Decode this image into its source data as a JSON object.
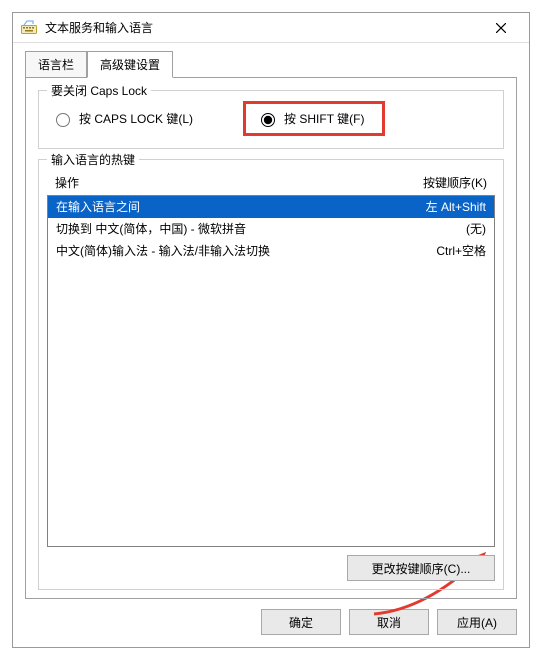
{
  "window": {
    "title": "文本服务和输入语言"
  },
  "tabs": {
    "tab0": "语言栏",
    "tab1": "高级键设置"
  },
  "capslock": {
    "group_label": "要关闭 Caps Lock",
    "radio_capslock": "按 CAPS LOCK 键(L)",
    "radio_shift": "按 SHIFT 键(F)"
  },
  "hotkeys": {
    "group_label": "输入语言的热键",
    "col_action": "操作",
    "col_keys": "按键顺序(K)",
    "rows": [
      {
        "action": "在输入语言之间",
        "keys": "左 Alt+Shift"
      },
      {
        "action": "切换到 中文(简体，中国) - 微软拼音",
        "keys": "(无)"
      },
      {
        "action": "中文(简体)输入法 - 输入法/非输入法切换",
        "keys": "Ctrl+空格"
      }
    ],
    "change_seq_btn": "更改按键顺序(C)..."
  },
  "buttons": {
    "ok": "确定",
    "cancel": "取消",
    "apply": "应用(A)"
  }
}
